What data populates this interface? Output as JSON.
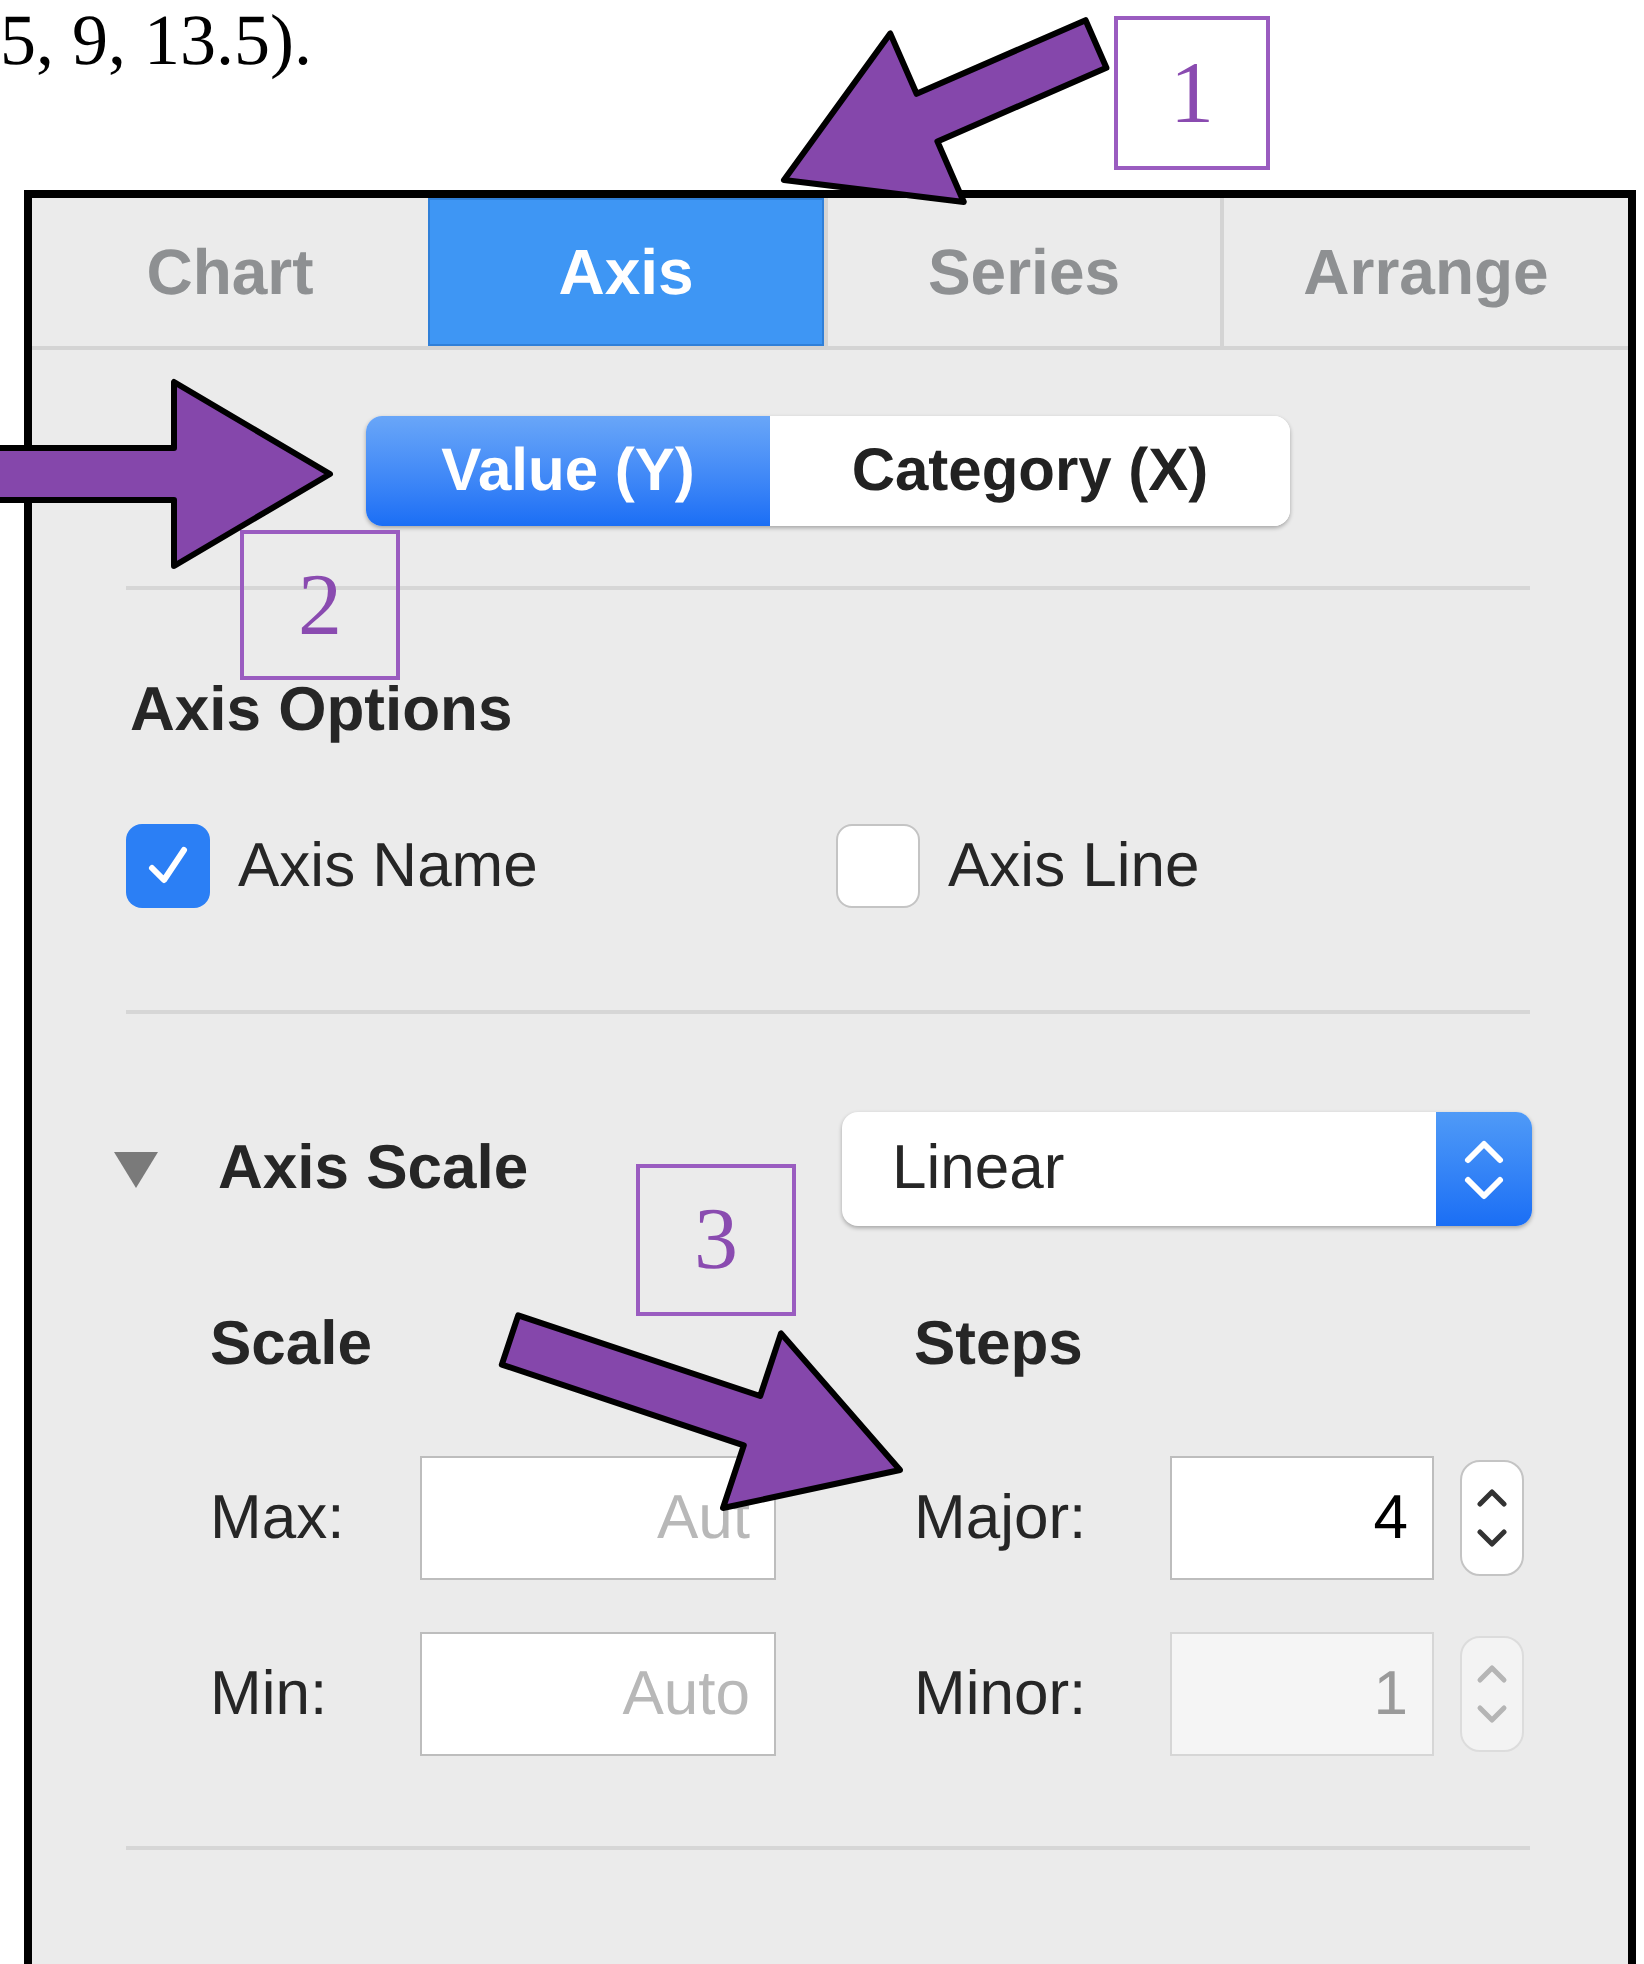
{
  "caption": "5, 9, 13.5).",
  "annotations": [
    {
      "label": "1"
    },
    {
      "label": "2"
    },
    {
      "label": "3"
    }
  ],
  "tabs": [
    {
      "label": "Chart",
      "selected": false
    },
    {
      "label": "Axis",
      "selected": true
    },
    {
      "label": "Series",
      "selected": false
    },
    {
      "label": "Arrange",
      "selected": false
    }
  ],
  "axis_switch": [
    {
      "label": "Value (Y)",
      "selected": true
    },
    {
      "label": "Category (X)",
      "selected": false
    }
  ],
  "axis_options": {
    "title": "Axis Options",
    "checkboxes": [
      {
        "label": "Axis Name",
        "checked": true
      },
      {
        "label": "Axis Line",
        "checked": false
      }
    ]
  },
  "axis_scale": {
    "title": "Axis Scale",
    "expanded": true,
    "type": "Linear",
    "scale": {
      "title": "Scale",
      "fields": [
        {
          "label": "Max:",
          "placeholder": "Aut"
        },
        {
          "label": "Min:",
          "placeholder": "Auto"
        }
      ]
    },
    "steps": {
      "title": "Steps",
      "fields": [
        {
          "label": "Major:",
          "value": "4",
          "disabled": false
        },
        {
          "label": "Minor:",
          "value": "1",
          "disabled": true
        }
      ]
    }
  }
}
